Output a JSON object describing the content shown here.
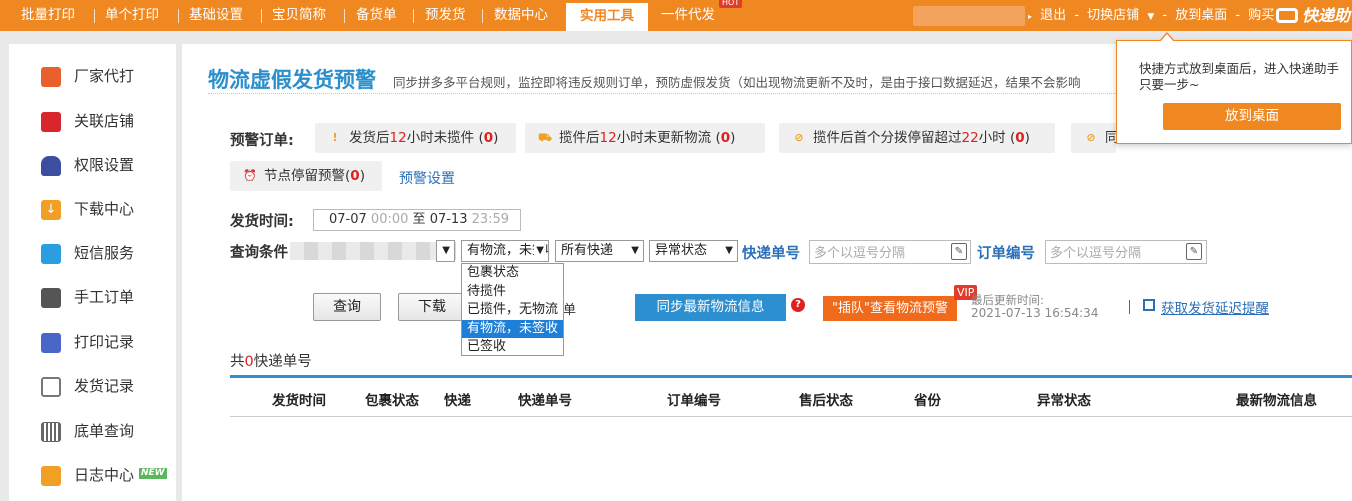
{
  "topnav": {
    "items": [
      "批量打印",
      "单个打印",
      "基础设置",
      "宝贝简称",
      "备货单",
      "预发货",
      "数据中心",
      "实用工具",
      "一件代发"
    ],
    "active": "实用工具",
    "hot_badge": "HOT",
    "logout": "退出",
    "switch_store": "切换店铺",
    "put_desktop": "放到桌面",
    "buy": "购买",
    "logo": "快递助"
  },
  "sidebar": {
    "items": [
      {
        "label": "厂家代打",
        "icon": "factory-icon",
        "color": "#e8612c"
      },
      {
        "label": "关联店铺",
        "icon": "dice-icon",
        "color": "#d9262b"
      },
      {
        "label": "权限设置",
        "icon": "lock-icon",
        "color": "#3b4ea0"
      },
      {
        "label": "下载中心",
        "icon": "download-icon",
        "color": "#f0a024"
      },
      {
        "label": "短信服务",
        "icon": "sms-icon",
        "color": "#2a9ee0"
      },
      {
        "label": "手工订单",
        "icon": "printer-icon",
        "color": "#555555"
      },
      {
        "label": "打印记录",
        "icon": "record-icon",
        "color": "#4a66c8"
      },
      {
        "label": "发货记录",
        "icon": "shipment-icon",
        "color": "#777777"
      },
      {
        "label": "底单查询",
        "icon": "barcode-icon",
        "color": "#666666"
      },
      {
        "label": "日志中心",
        "icon": "log-icon",
        "color": "#f0a024"
      }
    ],
    "new_badge": "NEW"
  },
  "main": {
    "title": "物流虚假发货预警",
    "description": "同步拼多多平台规则，监控即将违反规则订单，预防虚假发货（如出现物流更新不及时，是由于接口数据延迟，结果不会影响",
    "warning_label": "预警订单:",
    "chips": [
      {
        "pre": "发货后",
        "num": "12",
        "post": "小时未揽件",
        "count": "0",
        "icon": "exclamation-icon",
        "glyph": "!"
      },
      {
        "pre": "揽件后",
        "num": "12",
        "post": "小时未更新物流",
        "count": "0",
        "icon": "truck-icon",
        "glyph": "⛟"
      },
      {
        "pre": "揽件后首个分拨停留超过",
        "num": "22",
        "post": "小时",
        "count": "0",
        "icon": "ban-icon",
        "glyph": "⊘"
      },
      {
        "pre": "同",
        "num": "",
        "post": "",
        "count": "",
        "icon": "ban-icon",
        "glyph": "⊘"
      },
      {
        "pre": "节点停留预警",
        "num": "",
        "post": "",
        "count": "0",
        "icon": "alarm-icon",
        "glyph": "⏰"
      }
    ],
    "warning_settings": "预警设置",
    "ship_time_label": "发货时间:",
    "date_from": "07-07",
    "date_from_time": "00:00",
    "date_sep": "至",
    "date_to": "07-13",
    "date_to_time": "23:59",
    "query_label": "查询条件",
    "logistics_select": "有物流，未签收",
    "logistics_options": [
      "包裹状态",
      "待揽件",
      "已揽件，无物流",
      "有物流，未签收",
      "已签收"
    ],
    "courier_select": "所有快递",
    "abnormal_select": "异常状态",
    "tracking_label": "快递单号",
    "tracking_placeholder": "多个以逗号分隔",
    "order_label": "订单编号",
    "order_placeholder": "多个以逗号分隔",
    "query_btn": "查询",
    "download_btn": "下载",
    "download_suffix": "单",
    "sync_btn": "同步最新物流信息",
    "jump_btn": "\"插队\"查看物流预警",
    "vip": "VIP",
    "last_update_label": "最后更新时间:",
    "last_update_time": "2021-07-13 16:54:34",
    "delay_remind": "获取发货延迟提醒",
    "total_pre": "共",
    "total_count": "0",
    "total_post": "快递单号",
    "columns": [
      "发货时间",
      "包裹状态",
      "快递",
      "快递单号",
      "订单编号",
      "售后状态",
      "省份",
      "异常状态",
      "最新物流信息"
    ]
  },
  "popover": {
    "text": "快捷方式放到桌面后，进入快递助手只要一步~",
    "button": "放到桌面"
  }
}
